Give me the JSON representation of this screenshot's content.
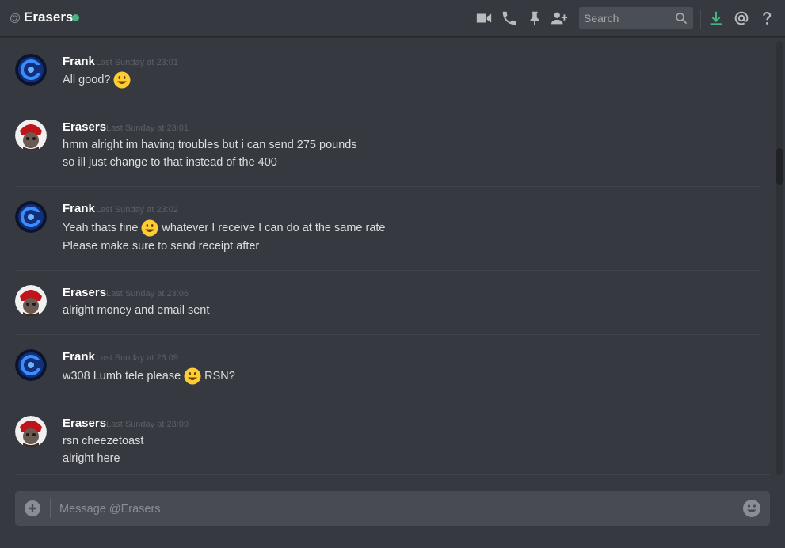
{
  "header": {
    "at_symbol": "@",
    "title": "Erasers",
    "status_color": "#43b581",
    "icons": [
      "video-camera-icon",
      "phone-icon",
      "pin-icon",
      "add-friend-icon",
      "download-icon",
      "mention-icon",
      "help-icon"
    ],
    "search_placeholder": "Search"
  },
  "colors": {
    "background": "#36393f",
    "header_text": "#ffffff",
    "timestamp": "#5c6066",
    "online": "#43b581"
  },
  "messages": [
    {
      "author": "Frank",
      "timestamp": "Last Sunday at 23:01",
      "lines": [
        {
          "before": "All good?",
          "emoji": "smiley",
          "after": ""
        }
      ]
    },
    {
      "author": "Erasers",
      "timestamp": "Last Sunday at 23:01",
      "lines": [
        {
          "before": "hmm alright im having troubles but i can send 275 pounds",
          "emoji": "",
          "after": ""
        },
        {
          "before": "so ill just change to that instead of the 400",
          "emoji": "",
          "after": ""
        }
      ]
    },
    {
      "author": "Frank",
      "timestamp": "Last Sunday at 23:02",
      "lines": [
        {
          "before": "Yeah thats fine",
          "emoji": "smiley",
          "after": "whatever I receive I can do at the same rate"
        },
        {
          "before": "Please make sure to send receipt after",
          "emoji": "",
          "after": ""
        }
      ]
    },
    {
      "author": "Erasers",
      "timestamp": "Last Sunday at 23:06",
      "lines": [
        {
          "before": "alright money and email sent",
          "emoji": "",
          "after": ""
        }
      ]
    },
    {
      "author": "Frank",
      "timestamp": "Last Sunday at 23:09",
      "lines": [
        {
          "before": "w308 Lumb tele please",
          "emoji": "smiley",
          "after": "RSN?"
        }
      ]
    },
    {
      "author": "Erasers",
      "timestamp": "Last Sunday at 23:09",
      "lines": [
        {
          "before": "rsn cheezetoast",
          "emoji": "",
          "after": ""
        },
        {
          "before": "alright here",
          "emoji": "",
          "after": ""
        }
      ]
    }
  ],
  "composer": {
    "placeholder": "Message @Erasers"
  }
}
